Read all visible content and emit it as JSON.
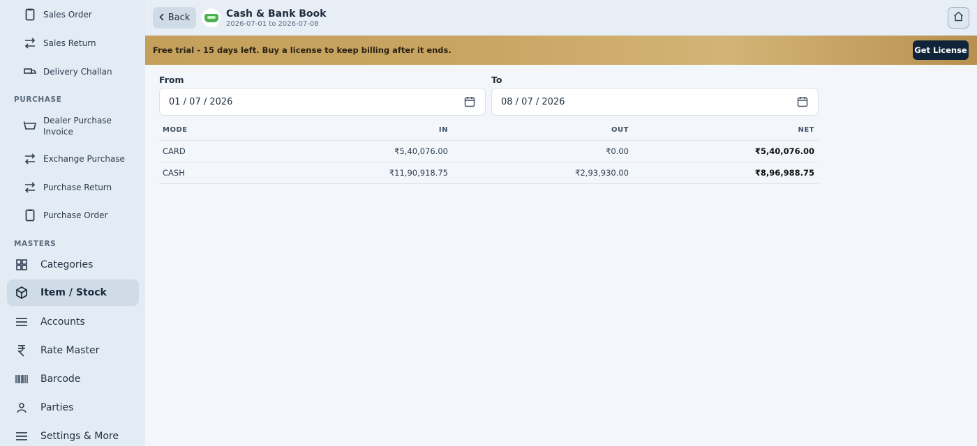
{
  "sidebar": {
    "sales_items": [
      {
        "label": "Sales Order",
        "icon": "clipboard-icon"
      },
      {
        "label": "Sales Return",
        "icon": "swap-arrows-icon"
      },
      {
        "label": "Delivery Challan",
        "icon": "truck-icon"
      }
    ],
    "purchase_heading": "PURCHASE",
    "purchase_items": [
      {
        "label": "Dealer Purchase Invoice",
        "icon": "basket-icon"
      },
      {
        "label": "Exchange Purchase",
        "icon": "swap-arrows-icon"
      },
      {
        "label": "Purchase Return",
        "icon": "swap-arrows-icon"
      },
      {
        "label": "Purchase Order",
        "icon": "clipboard-icon"
      }
    ],
    "masters_heading": "MASTERS",
    "master_items": [
      {
        "label": "Categories",
        "icon": "grid-icon"
      },
      {
        "label": "Item / Stock",
        "icon": "box-icon"
      },
      {
        "label": "Accounts",
        "icon": "menu-lines-icon"
      },
      {
        "label": "Rate Master",
        "icon": "rupee-icon"
      },
      {
        "label": "Barcode",
        "icon": "barcode-icon"
      },
      {
        "label": "Parties",
        "icon": "person-icon"
      },
      {
        "label": "Settings & More",
        "icon": "menu-lines-icon"
      }
    ]
  },
  "header": {
    "back_label": "Back",
    "title": "Cash & Bank Book",
    "subtitle": "2026-07-01 to 2026-07-08"
  },
  "banner": {
    "text": "Free trial - 15 days left. Buy a license to keep billing after it ends.",
    "button_label": "Get License"
  },
  "filters": {
    "from_label": "From",
    "from_value": "01 / 07 / 2026",
    "to_label": "To",
    "to_value": "08 / 07 / 2026"
  },
  "table": {
    "headers": {
      "mode": "MODE",
      "in": "IN",
      "out": "OUT",
      "net": "NET"
    },
    "rows": [
      {
        "mode": "CARD",
        "in": "₹5,40,076.00",
        "out": "₹0.00",
        "net": "₹5,40,076.00"
      },
      {
        "mode": "CASH",
        "in": "₹11,90,918.75",
        "out": "₹2,93,930.00",
        "net": "₹8,96,988.75"
      }
    ]
  }
}
